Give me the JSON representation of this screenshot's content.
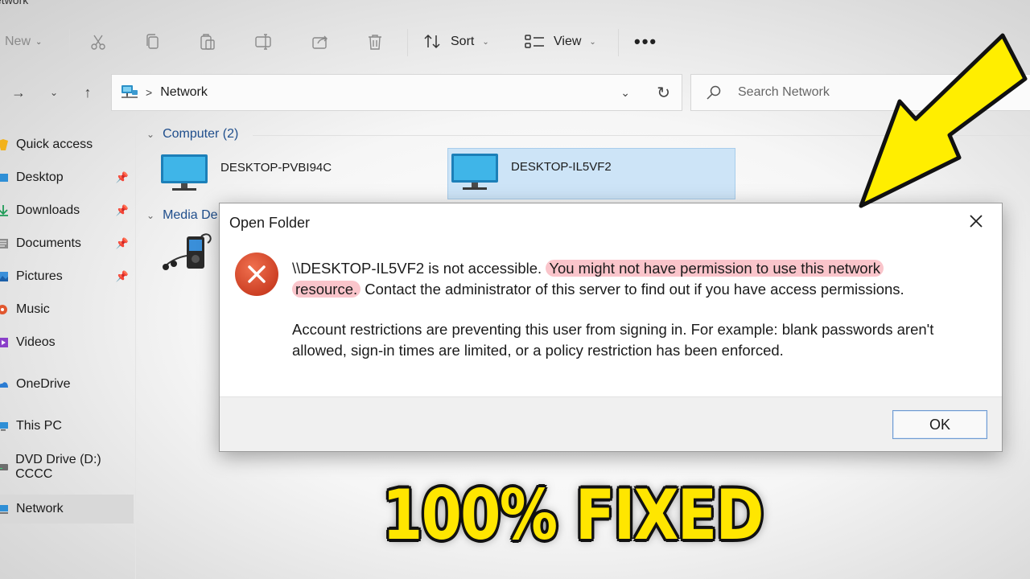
{
  "window": {
    "title_fragment": "etwork"
  },
  "toolbar": {
    "new_label": "New",
    "sort_label": "Sort",
    "view_label": "View",
    "more_label": "•••",
    "icons": [
      "cut-icon",
      "copy-icon",
      "paste-icon",
      "rename-icon",
      "share-icon",
      "delete-icon"
    ]
  },
  "address": {
    "location": "Network",
    "separator": ">",
    "search_placeholder": "Search Network"
  },
  "sidebar": {
    "items": [
      {
        "label": "Quick access",
        "icon": "star-icon",
        "pinned": false
      },
      {
        "label": "Desktop",
        "icon": "desktop-folder-icon",
        "pinned": true
      },
      {
        "label": "Downloads",
        "icon": "download-icon",
        "pinned": true
      },
      {
        "label": "Documents",
        "icon": "documents-icon",
        "pinned": true
      },
      {
        "label": "Pictures",
        "icon": "pictures-icon",
        "pinned": true
      },
      {
        "label": "Music",
        "icon": "music-icon",
        "pinned": false
      },
      {
        "label": "Videos",
        "icon": "videos-icon",
        "pinned": false
      },
      {
        "label": "OneDrive",
        "icon": "cloud-icon",
        "pinned": false
      },
      {
        "label": "This PC",
        "icon": "pc-icon",
        "pinned": false
      },
      {
        "label": "DVD Drive (D:) CCCC",
        "icon": "dvd-icon",
        "pinned": false
      },
      {
        "label": "Network",
        "icon": "network-icon",
        "pinned": false,
        "selected": true
      }
    ]
  },
  "content": {
    "groups": [
      {
        "label": "Computer (2)"
      },
      {
        "label": "Media De"
      }
    ],
    "computers": [
      {
        "name": "DESKTOP-PVBI94C",
        "selected": false
      },
      {
        "name": "DESKTOP-IL5VF2",
        "selected": true
      }
    ]
  },
  "dialog": {
    "title": "Open Folder",
    "path": "\\\\DESKTOP-IL5VF2",
    "message_part1": " is not accessible. ",
    "highlight_part1": "You might not have permission to use this network",
    "highlight_part2": "resource.",
    "message_part2": " Contact the administrator of this server to find out if you have access permissions.",
    "message_detail": "Account restrictions are preventing this user from signing in. For example: blank passwords aren't allowed, sign-in times are limited, or a policy restriction has been enforced.",
    "ok_label": "OK"
  },
  "overlay": {
    "caption": "100% FIXED",
    "arrow_color": "#ffee00",
    "caption_color": "#ffe600"
  },
  "colors": {
    "accent": "#1f4e8c",
    "selection": "#cde4f7",
    "highlight": "#f696a0",
    "error": "#d6452c"
  }
}
